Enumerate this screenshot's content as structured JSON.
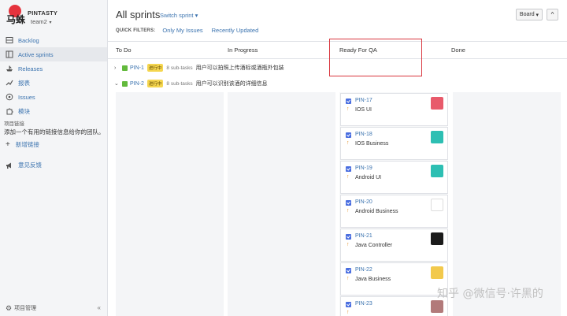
{
  "sidebar": {
    "logo_text": "马蛛",
    "project_name": "PINTASTY",
    "project_sub": "team2",
    "items": [
      {
        "label": "Backlog",
        "icon": "backlog-icon"
      },
      {
        "label": "Active sprints",
        "icon": "board-icon",
        "active": true
      },
      {
        "label": "Releases",
        "icon": "ship-icon"
      },
      {
        "label": "报表",
        "icon": "chart-icon"
      },
      {
        "label": "Issues",
        "icon": "issues-icon"
      },
      {
        "label": "模块",
        "icon": "puzzle-icon"
      }
    ],
    "section_label": "项目链接",
    "section_desc": "添加一个有用的链接信息给你的团队。",
    "add_link": "新增链接",
    "feedback": "意见反馈",
    "bottom": "项目管理",
    "collapse": "«"
  },
  "header": {
    "title": "All sprints",
    "switch_label": "Switch sprint",
    "board_btn": "Board",
    "collapse_btn": "^",
    "filters_label": "QUICK FILTERS:",
    "filters": [
      "Only My Issues",
      "Recently Updated"
    ]
  },
  "columns": [
    "To Do",
    "In Progress",
    "Ready For QA",
    "Done"
  ],
  "swimlanes": [
    {
      "chevron": "›",
      "key": "PIN-1",
      "status": "进行中",
      "subtasks": "8 sub-tasks",
      "summary": "用户可以拍照上传酒标或酒瓶外包装"
    },
    {
      "chevron": "⌄",
      "key": "PIN-2",
      "status": "进行中",
      "subtasks": "8 sub-tasks",
      "summary": "用户可以识别该酒的详细信息"
    }
  ],
  "cards": [
    {
      "key": "PIN-17",
      "summary": "IOS UI",
      "avatar": "#e85a6b",
      "avatar_icon": "pink-square-avatar"
    },
    {
      "key": "PIN-18",
      "summary": "IOS Business",
      "avatar": "#2dbfb3",
      "avatar_icon": "teal-robot-avatar"
    },
    {
      "key": "PIN-19",
      "summary": "Android UI",
      "avatar": "#2dbfb3",
      "avatar_icon": "teal-robot-avatar"
    },
    {
      "key": "PIN-20",
      "summary": "Android Business",
      "avatar": "#ffffff",
      "avatar_icon": "ghost-avatar"
    },
    {
      "key": "PIN-21",
      "summary": "Java Controller",
      "avatar": "#1b1b1b",
      "avatar_icon": "dark-avatar"
    },
    {
      "key": "PIN-22",
      "summary": "Java Business",
      "avatar": "#f2c94c",
      "avatar_icon": "cartoon-avatar"
    },
    {
      "key": "PIN-23",
      "summary": "",
      "avatar": "#b27a7a",
      "avatar_icon": "photo-avatar"
    }
  ],
  "watermark": "知乎 @微信号·许黑的"
}
